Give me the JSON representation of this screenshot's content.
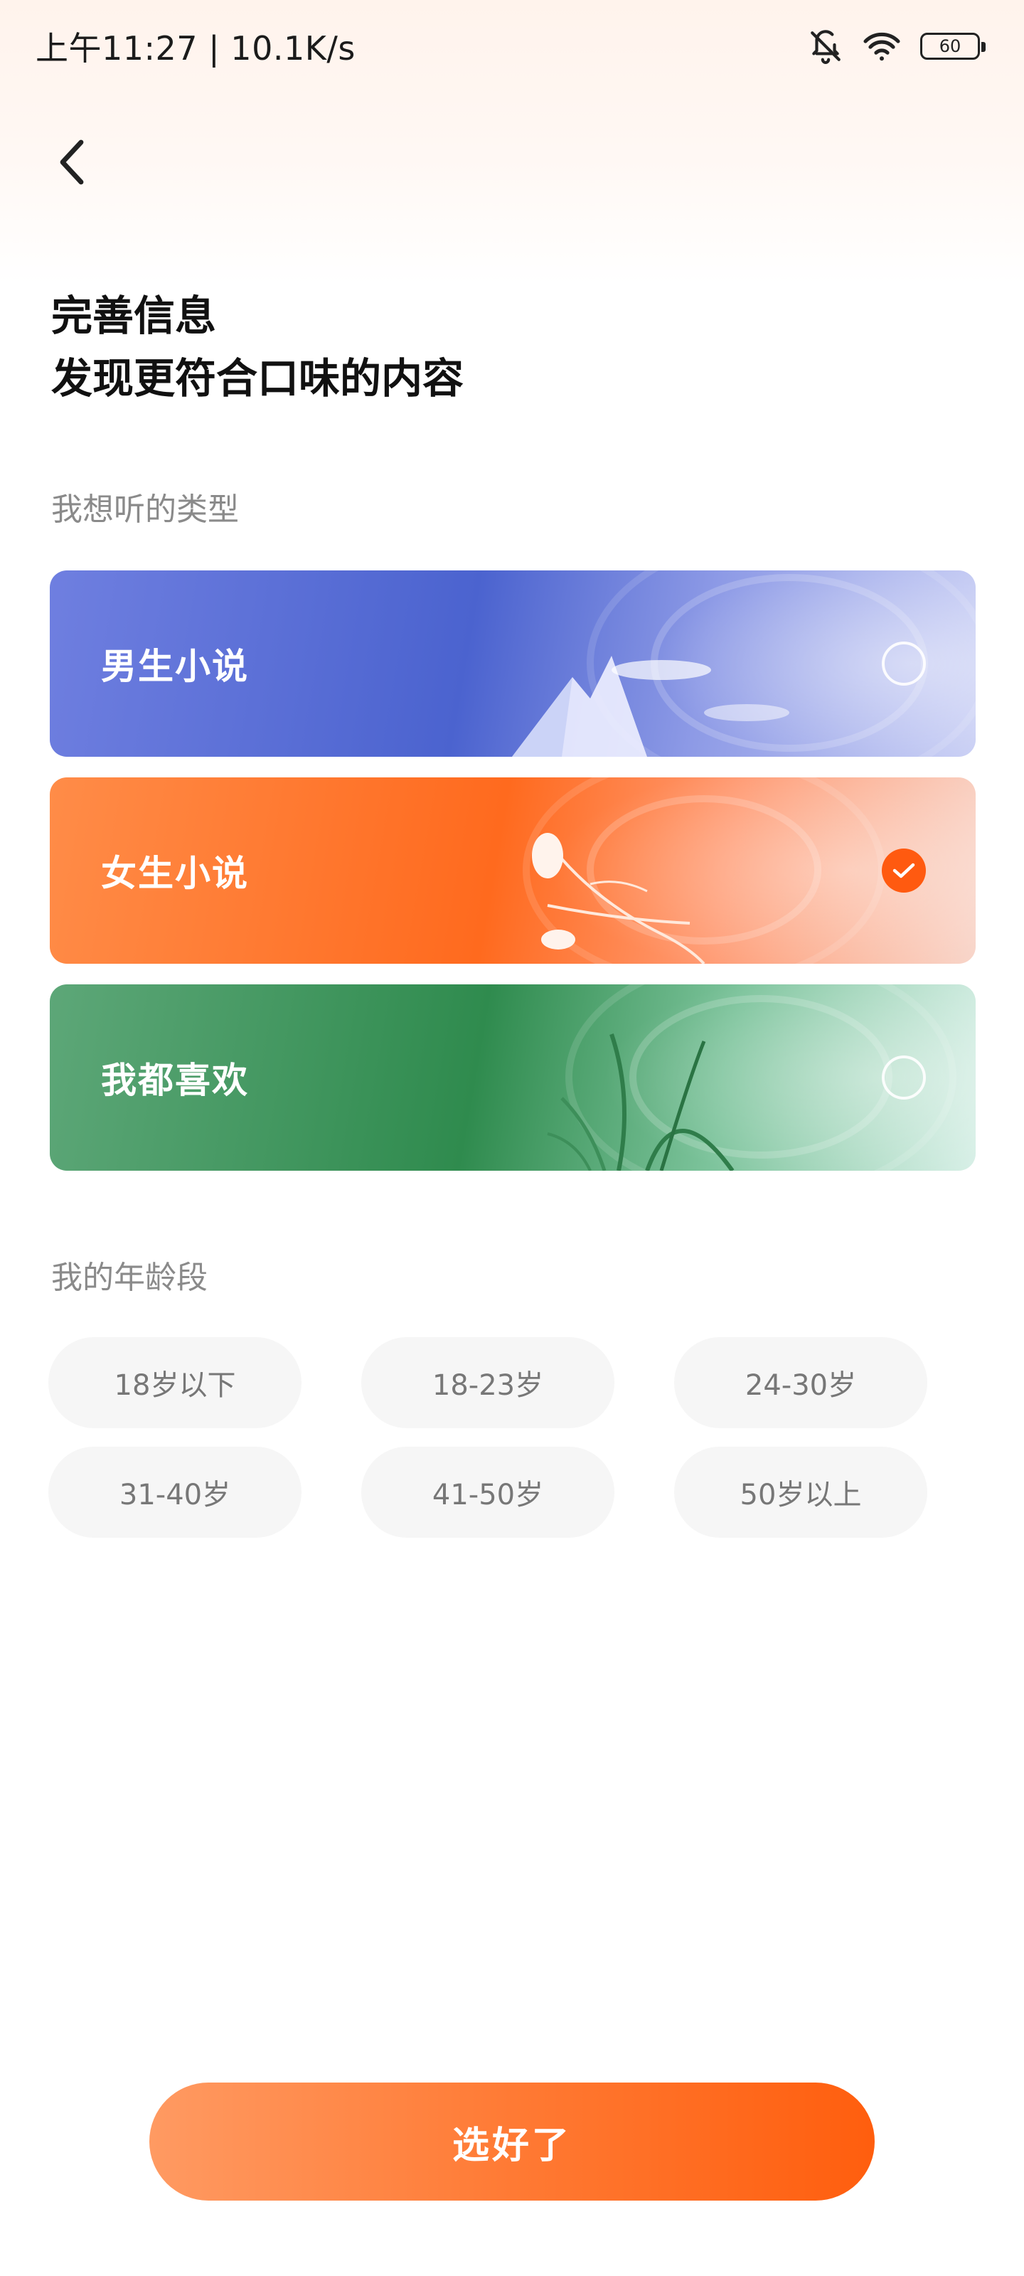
{
  "status_bar": {
    "time_speed": "上午11:27 | 10.1K/s",
    "battery_level": "60",
    "icons": [
      "bell-muted-icon",
      "wifi-icon",
      "battery-icon"
    ]
  },
  "header": {
    "back_icon": "chevron-left-icon",
    "title_line1": "完善信息",
    "title_line2": "发现更符合口味的内容"
  },
  "genre_section": {
    "label": "我想听的类型",
    "options": [
      {
        "label": "男生小说",
        "selected": false,
        "color": "#4b63cf"
      },
      {
        "label": "女生小说",
        "selected": true,
        "color": "#ff6a1e"
      },
      {
        "label": "我都喜欢",
        "selected": false,
        "color": "#2f8b4e"
      }
    ]
  },
  "age_section": {
    "label": "我的年龄段",
    "options": [
      "18岁以下",
      "18-23岁",
      "24-30岁",
      "31-40岁",
      "41-50岁",
      "50岁以上"
    ]
  },
  "confirm_button": {
    "label": "选好了"
  },
  "colors": {
    "accent": "#ff5e0e",
    "chip_bg": "#f6f6f6",
    "muted_text": "#8a8a8a"
  }
}
